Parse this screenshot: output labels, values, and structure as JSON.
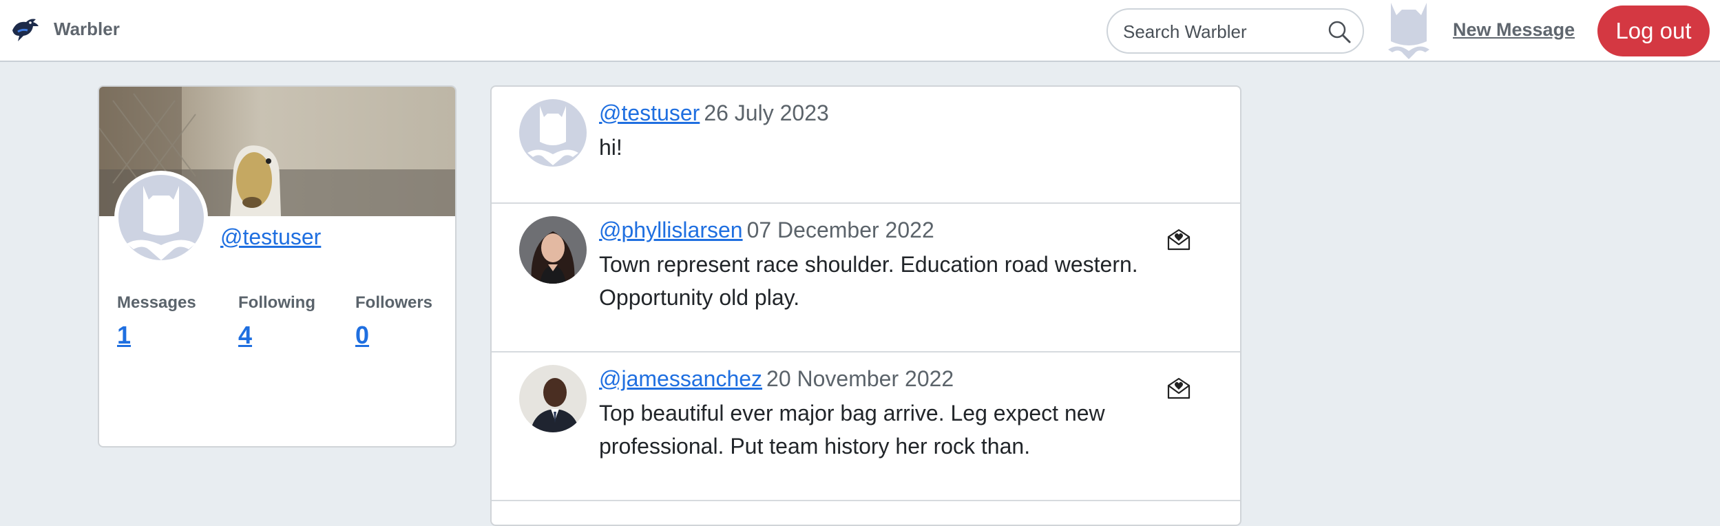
{
  "navbar": {
    "brand": "Warbler",
    "search_placeholder": "Search Warbler",
    "new_message": "New Message",
    "logout": "Log out",
    "icons": {
      "logo": "bird-logo-icon",
      "search": "search-icon",
      "avatar": "default-bat-avatar"
    }
  },
  "profile": {
    "username": "@testuser",
    "stats": [
      {
        "label": "Messages",
        "value": "1"
      },
      {
        "label": "Following",
        "value": "4"
      },
      {
        "label": "Followers",
        "value": "0"
      }
    ]
  },
  "messages": [
    {
      "user": "@testuser",
      "date": "26 July 2023",
      "text": "hi!",
      "avatar": "default-bat-avatar",
      "liked": false
    },
    {
      "user": "@phyllislarsen",
      "date": "07 December 2022",
      "text": "Town represent race shoulder. Education road western. Opportunity old play.",
      "avatar": "woman-photo-avatar",
      "liked": true
    },
    {
      "user": "@jamessanchez",
      "date": "20 November 2022",
      "text": "Top beautiful ever major bag arrive. Leg expect new professional. Put team history her rock than.",
      "avatar": "man-photo-avatar",
      "liked": true
    }
  ],
  "colors": {
    "accent": "#1f6fe0",
    "danger": "#d43842",
    "background": "#e8edf1"
  }
}
